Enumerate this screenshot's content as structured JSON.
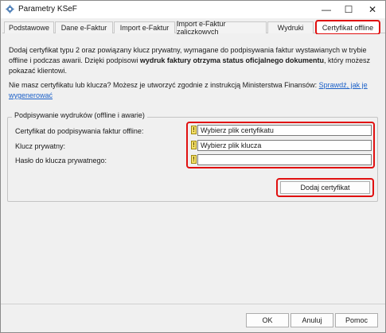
{
  "window": {
    "title": "Parametry KSeF",
    "min_glyph": "—",
    "max_glyph": "☐",
    "close_glyph": "✕",
    "app_icon": "ksef-gear-icon"
  },
  "tabs": [
    {
      "label": "Podstawowe"
    },
    {
      "label": "Dane e-Faktur"
    },
    {
      "label": "Import e-Faktur"
    },
    {
      "label": "Import e-Faktur zaliczkowych"
    },
    {
      "label": "Wydruki"
    },
    {
      "label": "Certyfikat offline"
    }
  ],
  "active_tab": "Certyfikat offline",
  "description": {
    "part1": "Dodaj certyfikat typu 2 oraz powiązany klucz prywatny, wymagane do podpisywania faktur wystawianych w trybie offline i podczas awarii. Dzięki podpisowi ",
    "bold": "wydruk faktury otrzyma status oficjalnego dokumentu",
    "part2": ", który możesz pokazać klientowi."
  },
  "hint": {
    "text": "Nie masz certyfikatu lub klucza? Możesz je utworzyć zgodnie z instrukcją Ministerstwa Finansów: ",
    "link": "Sprawdź, jak je wygenerować"
  },
  "group": {
    "title": "Podpisywanie wydruków (offline i awarie)",
    "cert_label": "Certyfikat do podpisywania faktur offline:",
    "cert_value": "Wybierz plik certyfikatu",
    "key_label": "Klucz prywatny:",
    "key_value": "Wybierz plik klucza",
    "pass_label": "Hasło do klucza prywatnego:",
    "pass_value": "",
    "warn_glyph": "!",
    "add_button": "Dodaj certyfikat"
  },
  "footer": {
    "ok": "OK",
    "cancel": "Anuluj",
    "help": "Pomoc"
  },
  "colors": {
    "highlight": "#e01010",
    "link": "#1a5fc8",
    "warning": "#f5e16a"
  }
}
